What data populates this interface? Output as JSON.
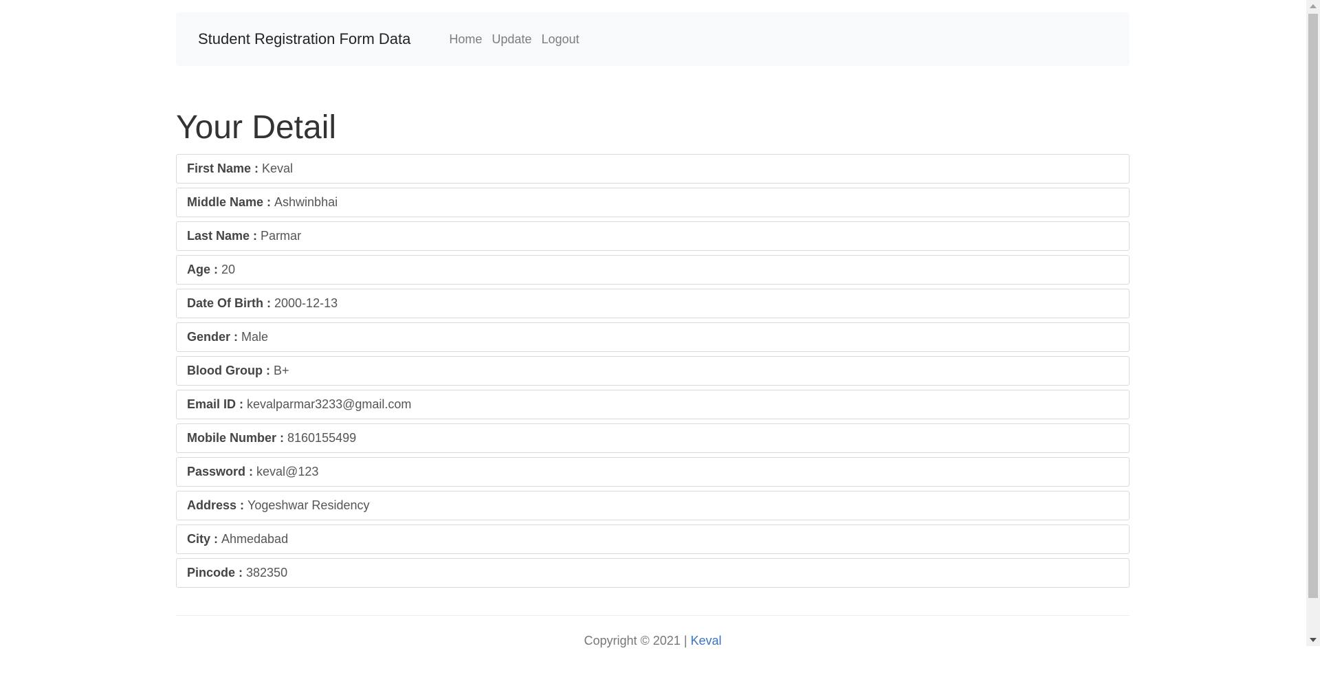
{
  "navbar": {
    "brand": "Student Registration Form Data",
    "links": [
      "Home",
      "Update",
      "Logout"
    ]
  },
  "main": {
    "heading": "Your Detail",
    "fields": [
      {
        "label": "First Name :",
        "value": "Keval"
      },
      {
        "label": "Middle Name :",
        "value": "Ashwinbhai"
      },
      {
        "label": "Last Name :",
        "value": "Parmar"
      },
      {
        "label": "Age :",
        "value": "20"
      },
      {
        "label": "Date Of Birth :",
        "value": "2000-12-13"
      },
      {
        "label": "Gender :",
        "value": "Male"
      },
      {
        "label": "Blood Group :",
        "value": "B+"
      },
      {
        "label": "Email ID :",
        "value": "kevalparmar3233@gmail.com"
      },
      {
        "label": "Mobile Number :",
        "value": "8160155499"
      },
      {
        "label": "Password :",
        "value": "keval@123"
      },
      {
        "label": "Address :",
        "value": "Yogeshwar Residency"
      },
      {
        "label": "City :",
        "value": "Ahmedabad"
      },
      {
        "label": "Pincode :",
        "value": "382350"
      }
    ]
  },
  "footer": {
    "copyright": "Copyright © 2021 |",
    "author": "Keval"
  }
}
